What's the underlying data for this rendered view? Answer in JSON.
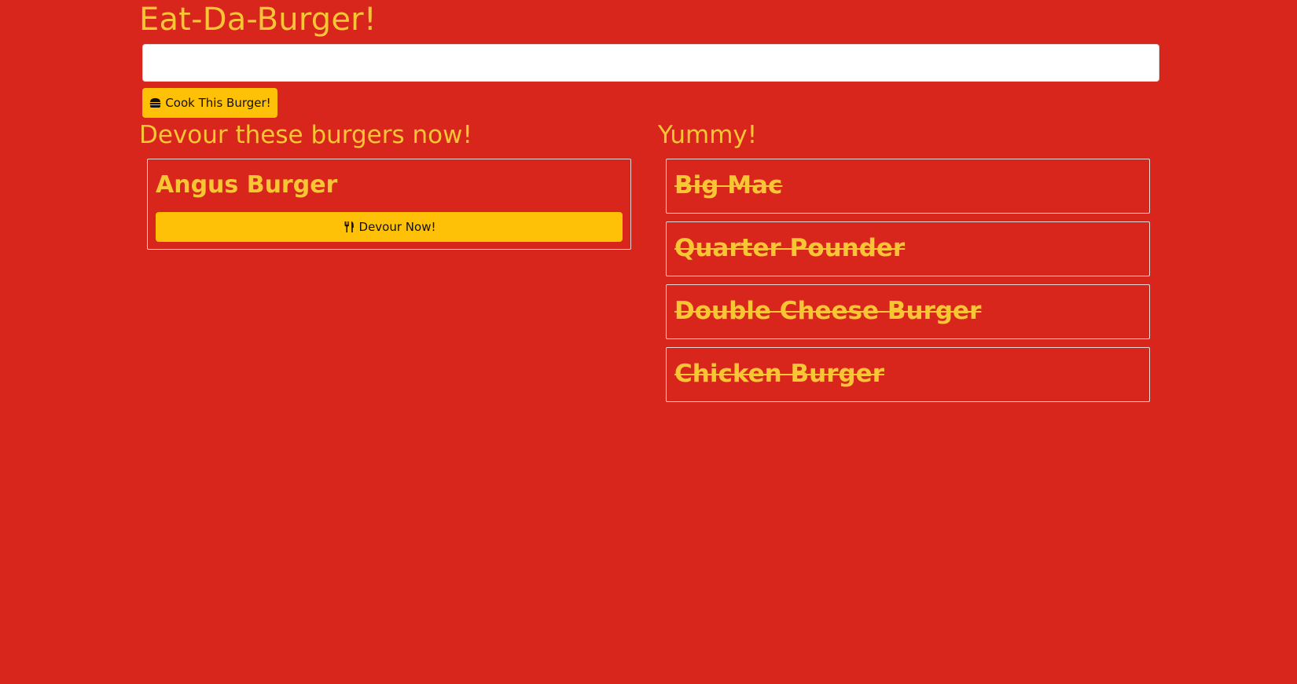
{
  "page": {
    "title": "Eat-Da-Burger!"
  },
  "form": {
    "input_value": "",
    "input_placeholder": "",
    "cook_button_label": "Cook This Burger!",
    "cook_button_icon": "hamburger-icon"
  },
  "devour_section": {
    "title": "Devour these burgers now!",
    "burgers": [
      {
        "name": "Angus Burger",
        "button_label": "Devour Now!",
        "button_icon": "utensils-icon"
      }
    ]
  },
  "eaten_section": {
    "title": "Yummy!",
    "burgers": [
      {
        "name": "Big Mac"
      },
      {
        "name": "Quarter Pounder"
      },
      {
        "name": "Double Cheese Burger"
      },
      {
        "name": "Chicken Burger"
      }
    ]
  },
  "colors": {
    "background": "#d9261c",
    "accent_text": "#f8c635",
    "button": "#ffc107",
    "border": "#f2d6d3"
  }
}
